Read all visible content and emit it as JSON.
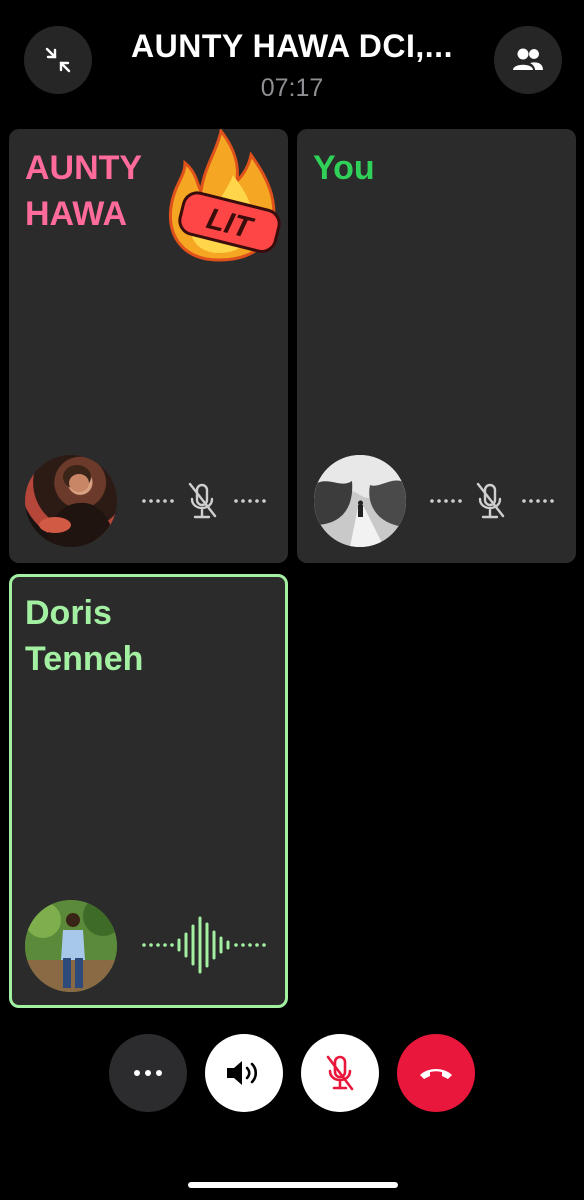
{
  "header": {
    "title": "AUNTY HAWA DCI,...",
    "timer": "07:17",
    "left_icon": "minimize-arrows-icon",
    "right_icon": "people-icon"
  },
  "participants": [
    {
      "name_line1": "AUNTY",
      "name_line2": "HAWA",
      "sticker_text": "LIT",
      "name_color": "#ff6b9a",
      "muted": true,
      "avatar": "avatar-photo-aunty-hawa"
    },
    {
      "name_line1": "You",
      "name_line2": "",
      "name_color": "#2fd158",
      "muted": true,
      "avatar": "avatar-photo-you"
    },
    {
      "name_line1": "Doris",
      "name_line2": "Tenneh",
      "name_color": "#a3f0a3",
      "speaking": true,
      "muted": false,
      "avatar": "avatar-photo-doris"
    }
  ],
  "controls": [
    {
      "icon": "more-dots-icon",
      "color": "#2c2c2e"
    },
    {
      "icon": "speaker-icon",
      "color": "#ffffff"
    },
    {
      "icon": "mic-muted-icon",
      "color": "#ffffff"
    },
    {
      "icon": "end-call-icon",
      "color": "#e8173b"
    }
  ]
}
